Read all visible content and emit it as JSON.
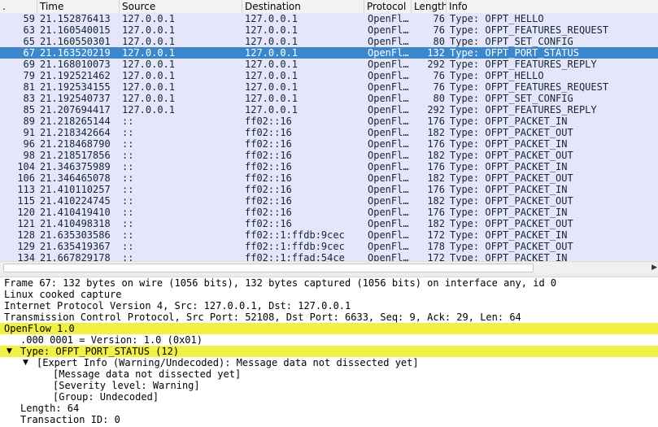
{
  "packet_list": {
    "columns": {
      "no": ".",
      "time": "Time",
      "source": "Source",
      "destination": "Destination",
      "protocol": "Protocol",
      "length": "Length",
      "info": "Info"
    },
    "rows": [
      {
        "no": "59",
        "time": "21.152876413",
        "src": "127.0.0.1",
        "dst": "127.0.0.1",
        "proto": "OpenFl…",
        "len": "76",
        "info": "Type: OFPT_HELLO"
      },
      {
        "no": "63",
        "time": "21.160540015",
        "src": "127.0.0.1",
        "dst": "127.0.0.1",
        "proto": "OpenFl…",
        "len": "76",
        "info": "Type: OFPT_FEATURES_REQUEST"
      },
      {
        "no": "65",
        "time": "21.160550301",
        "src": "127.0.0.1",
        "dst": "127.0.0.1",
        "proto": "OpenFl…",
        "len": "80",
        "info": "Type: OFPT_SET_CONFIG"
      },
      {
        "no": "67",
        "time": "21.163520219",
        "src": "127.0.0.1",
        "dst": "127.0.0.1",
        "proto": "OpenFl…",
        "len": "132",
        "info": "Type: OFPT_PORT_STATUS",
        "selected": true
      },
      {
        "no": "69",
        "time": "21.168010073",
        "src": "127.0.0.1",
        "dst": "127.0.0.1",
        "proto": "OpenFl…",
        "len": "292",
        "info": "Type: OFPT_FEATURES_REPLY"
      },
      {
        "no": "79",
        "time": "21.192521462",
        "src": "127.0.0.1",
        "dst": "127.0.0.1",
        "proto": "OpenFl…",
        "len": "76",
        "info": "Type: OFPT_HELLO"
      },
      {
        "no": "81",
        "time": "21.192534155",
        "src": "127.0.0.1",
        "dst": "127.0.0.1",
        "proto": "OpenFl…",
        "len": "76",
        "info": "Type: OFPT_FEATURES_REQUEST"
      },
      {
        "no": "83",
        "time": "21.192540737",
        "src": "127.0.0.1",
        "dst": "127.0.0.1",
        "proto": "OpenFl…",
        "len": "80",
        "info": "Type: OFPT_SET_CONFIG"
      },
      {
        "no": "85",
        "time": "21.207694417",
        "src": "127.0.0.1",
        "dst": "127.0.0.1",
        "proto": "OpenFl…",
        "len": "292",
        "info": "Type: OFPT_FEATURES_REPLY"
      },
      {
        "no": "89",
        "time": "21.218265144",
        "src": "::",
        "dst": "ff02::16",
        "proto": "OpenFl…",
        "len": "176",
        "info": "Type: OFPT_PACKET_IN"
      },
      {
        "no": "91",
        "time": "21.218342664",
        "src": "::",
        "dst": "ff02::16",
        "proto": "OpenFl…",
        "len": "182",
        "info": "Type: OFPT_PACKET_OUT"
      },
      {
        "no": "96",
        "time": "21.218468790",
        "src": "::",
        "dst": "ff02::16",
        "proto": "OpenFl…",
        "len": "176",
        "info": "Type: OFPT_PACKET_IN"
      },
      {
        "no": "98",
        "time": "21.218517856",
        "src": "::",
        "dst": "ff02::16",
        "proto": "OpenFl…",
        "len": "182",
        "info": "Type: OFPT_PACKET_OUT"
      },
      {
        "no": "104",
        "time": "21.346375989",
        "src": "::",
        "dst": "ff02::16",
        "proto": "OpenFl…",
        "len": "176",
        "info": "Type: OFPT_PACKET_IN"
      },
      {
        "no": "106",
        "time": "21.346465078",
        "src": "::",
        "dst": "ff02::16",
        "proto": "OpenFl…",
        "len": "182",
        "info": "Type: OFPT_PACKET_OUT"
      },
      {
        "no": "113",
        "time": "21.410110257",
        "src": "::",
        "dst": "ff02::16",
        "proto": "OpenFl…",
        "len": "176",
        "info": "Type: OFPT_PACKET_IN"
      },
      {
        "no": "115",
        "time": "21.410224745",
        "src": "::",
        "dst": "ff02::16",
        "proto": "OpenFl…",
        "len": "182",
        "info": "Type: OFPT_PACKET_OUT"
      },
      {
        "no": "120",
        "time": "21.410419410",
        "src": "::",
        "dst": "ff02::16",
        "proto": "OpenFl…",
        "len": "176",
        "info": "Type: OFPT_PACKET_IN"
      },
      {
        "no": "121",
        "time": "21.410498318",
        "src": "::",
        "dst": "ff02::16",
        "proto": "OpenFl…",
        "len": "182",
        "info": "Type: OFPT_PACKET_OUT"
      },
      {
        "no": "128",
        "time": "21.635303586",
        "src": "::",
        "dst": "ff02::1:ffdb:9cec",
        "proto": "OpenFl…",
        "len": "172",
        "info": "Type: OFPT_PACKET_IN"
      },
      {
        "no": "129",
        "time": "21.635419367",
        "src": "::",
        "dst": "ff02::1:ffdb:9cec",
        "proto": "OpenFl…",
        "len": "178",
        "info": "Type: OFPT_PACKET_OUT"
      },
      {
        "no": "134",
        "time": "21.667829178",
        "src": "::",
        "dst": "ff02::1:ffad:54ce",
        "proto": "OpenFl…",
        "len": "172",
        "info": "Type: OFPT_PACKET_IN"
      }
    ]
  },
  "colors": {
    "row_bg": "#e6e6fa",
    "row_fg": "#12272e",
    "selected_bg": "#3c87c9",
    "selected_fg": "#ffffff",
    "highlight_bg": "#f1f044"
  },
  "details": [
    {
      "text": "Frame 67: 132 bytes on wire (1056 bits), 132 bytes captured (1056 bits) on interface any, id 0",
      "indent": 0,
      "toggle": "none",
      "highlight": false
    },
    {
      "text": "Linux cooked capture",
      "indent": 0,
      "toggle": "none",
      "highlight": false
    },
    {
      "text": "Internet Protocol Version 4, Src: 127.0.0.1, Dst: 127.0.0.1",
      "indent": 0,
      "toggle": "none",
      "highlight": false
    },
    {
      "text": "Transmission Control Protocol, Src Port: 52108, Dst Port: 6633, Seq: 9, Ack: 29, Len: 64",
      "indent": 0,
      "toggle": "none",
      "highlight": false
    },
    {
      "text": "OpenFlow 1.0",
      "indent": 0,
      "toggle": "none",
      "highlight": true
    },
    {
      "text": ".000 0001 = Version: 1.0 (0x01)",
      "indent": 1,
      "toggle": "none",
      "highlight": false
    },
    {
      "text": "Type: OFPT_PORT_STATUS (12)",
      "indent": 1,
      "toggle": "expanded",
      "highlight": true
    },
    {
      "text": "[Expert Info (Warning/Undecoded): Message data not dissected yet]",
      "indent": 2,
      "toggle": "expanded",
      "highlight": false
    },
    {
      "text": "[Message data not dissected yet]",
      "indent": 3,
      "toggle": "none",
      "highlight": false
    },
    {
      "text": "[Severity level: Warning]",
      "indent": 3,
      "toggle": "none",
      "highlight": false
    },
    {
      "text": "[Group: Undecoded]",
      "indent": 3,
      "toggle": "none",
      "highlight": false
    },
    {
      "text": "Length: 64",
      "indent": 1,
      "toggle": "none",
      "highlight": false
    },
    {
      "text": "Transaction ID: 0",
      "indent": 1,
      "toggle": "none",
      "highlight": false
    }
  ]
}
